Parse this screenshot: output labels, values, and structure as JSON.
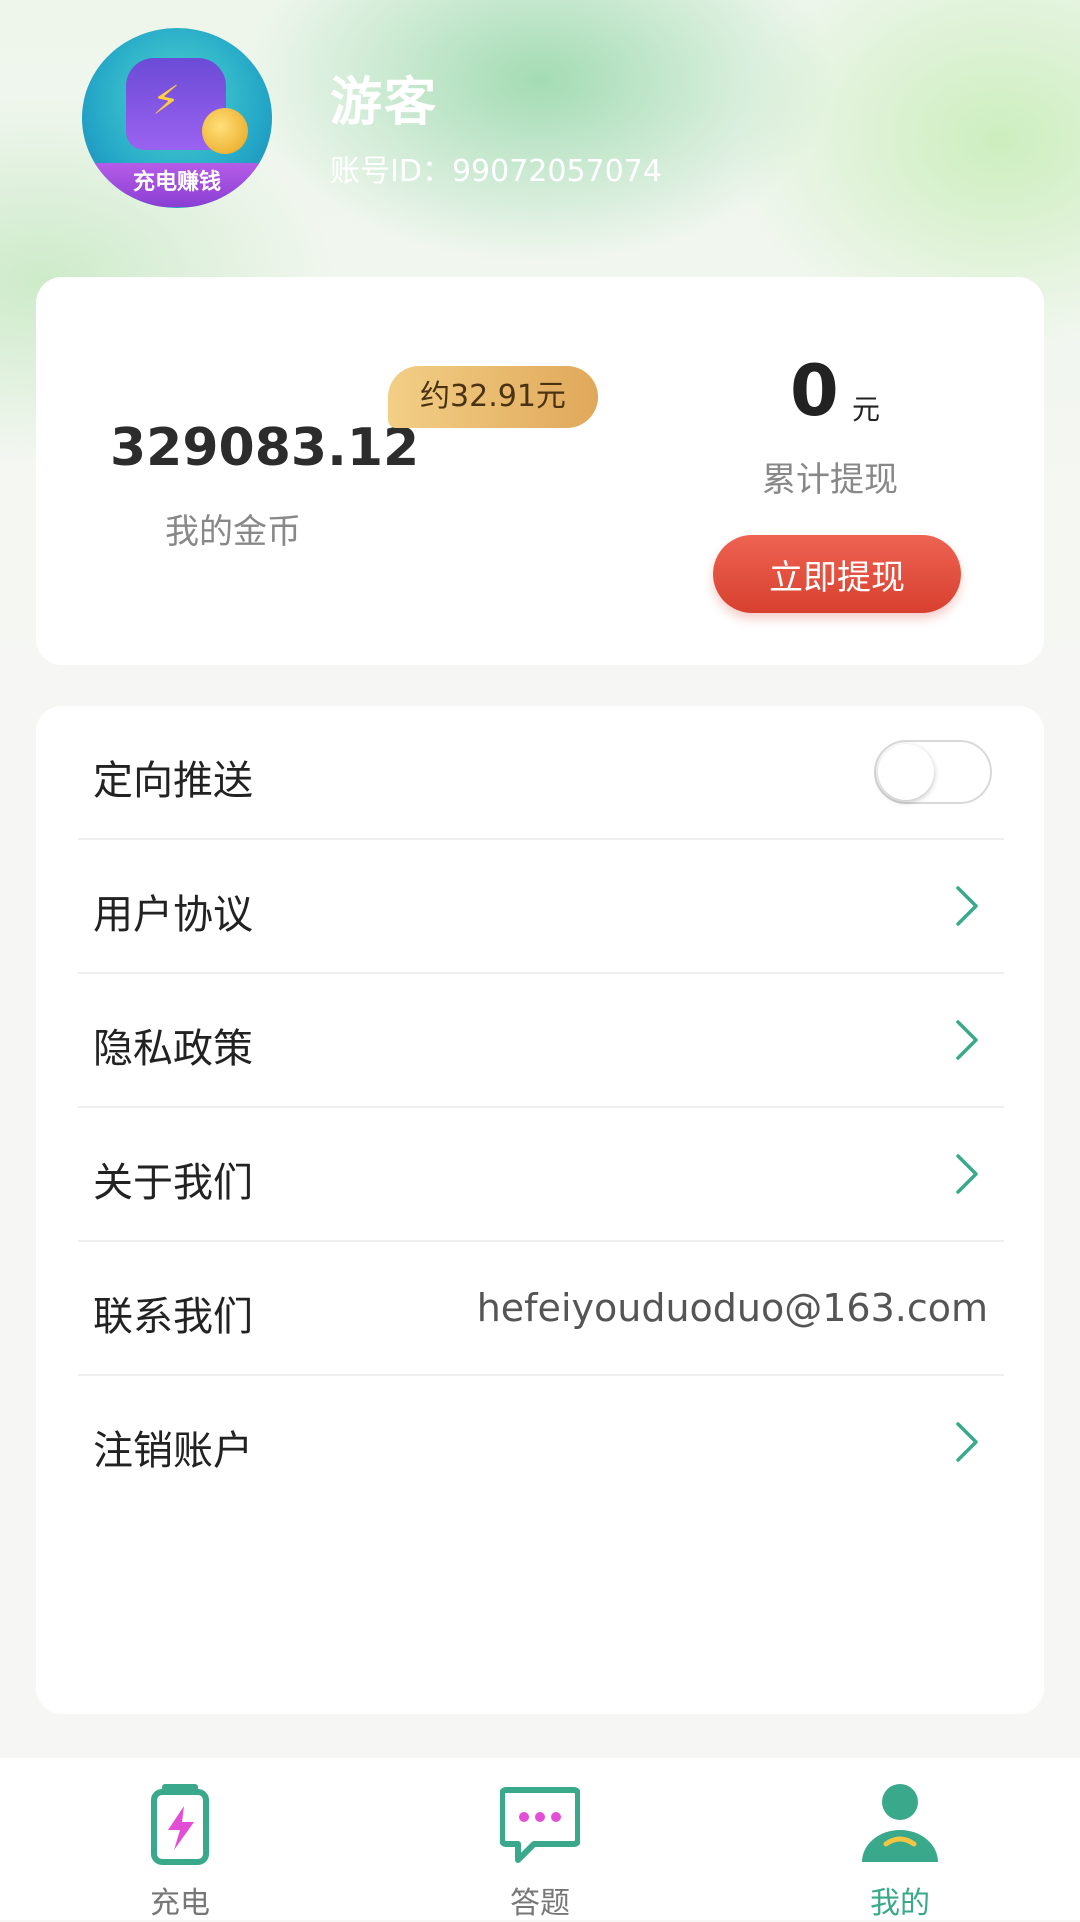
{
  "profile": {
    "avatar_badge_text": "充电赚钱",
    "username": "游客",
    "account_id": "账号ID：99072057074"
  },
  "wallet": {
    "coins": "329083.12",
    "coins_label": "我的金币",
    "approx_value": "约32.91元",
    "total_withdrawn": "0",
    "total_withdrawn_unit": "元",
    "total_withdrawn_label": "累计提现",
    "withdraw_button": "立即提现"
  },
  "settings": {
    "targeted_push": {
      "label": "定向推送",
      "enabled": false
    },
    "user_agreement": "用户协议",
    "privacy_policy": "隐私政策",
    "about_us": "关于我们",
    "contact_us": {
      "label": "联系我们",
      "email": "hefeiyouduoduo@163.com"
    },
    "delete_account": "注销账户"
  },
  "tabbar": {
    "charge": "充电",
    "quiz": "答题",
    "mine": "我的",
    "active": "mine"
  },
  "colors": {
    "accent": "#3aa88a",
    "withdraw_button": "#e24e3c",
    "badge_gold": "#e9bc6e"
  }
}
